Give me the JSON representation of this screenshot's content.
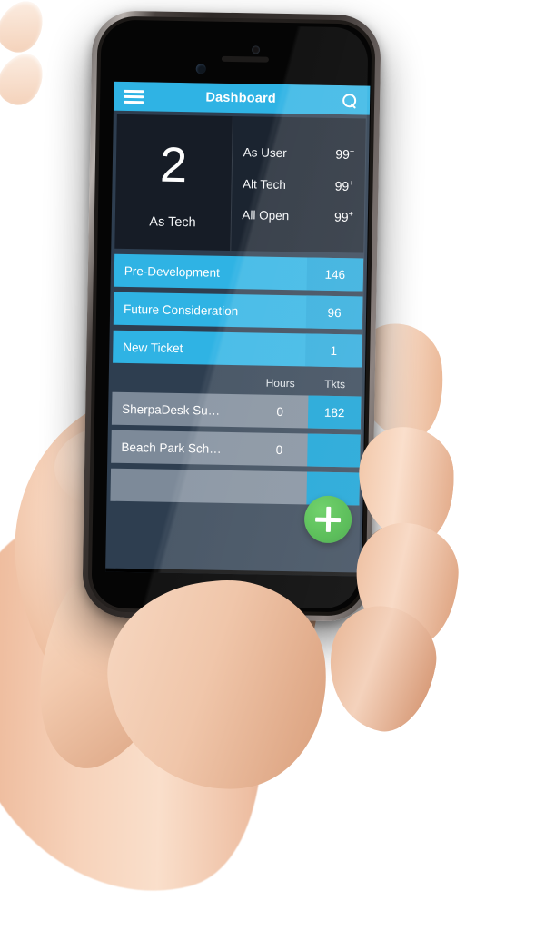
{
  "app": {
    "title": "Dashboard",
    "menu_icon": "hamburger-icon",
    "search_icon": "search-icon",
    "accent_color": "#2fb3e4",
    "background_color": "#2e3e50",
    "fab_color": "#3cb23a"
  },
  "stats": {
    "primary": {
      "value": "2",
      "label": "As Tech"
    },
    "rows": [
      {
        "label": "As User",
        "value": "99",
        "suffix": "+"
      },
      {
        "label": "Alt Tech",
        "value": "99",
        "suffix": "+"
      },
      {
        "label": "All Open",
        "value": "99",
        "suffix": "+"
      }
    ]
  },
  "queues": [
    {
      "name": "Pre-Development",
      "count": "146"
    },
    {
      "name": "Future Consideration",
      "count": "96"
    },
    {
      "name": "New Ticket",
      "count": "1"
    }
  ],
  "table": {
    "headers": {
      "hours": "Hours",
      "tickets": "Tkts"
    },
    "rows": [
      {
        "name": "SherpaDesk Su…",
        "hours": "0",
        "tickets": "182"
      },
      {
        "name": "Beach Park Sch…",
        "hours": "0",
        "tickets": ""
      },
      {
        "name": "",
        "hours": "",
        "tickets": ""
      }
    ]
  },
  "fab": {
    "label": "+",
    "icon": "plus-icon"
  }
}
